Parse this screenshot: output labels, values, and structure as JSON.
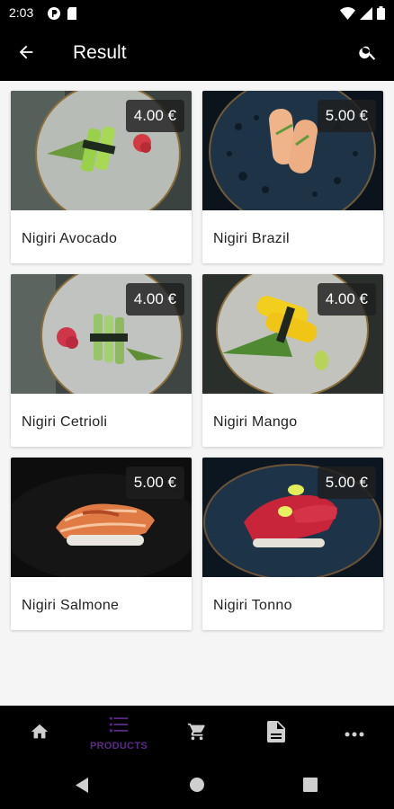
{
  "status_bar": {
    "time": "2:03",
    "icons": [
      "media-icon",
      "sim-card-icon",
      "wifi-icon",
      "signal-icon",
      "battery-icon"
    ]
  },
  "app_bar": {
    "title": "Result",
    "back_icon": "arrow-back-icon",
    "search_icon": "search-icon"
  },
  "products": [
    {
      "name": "Nigiri Avocado",
      "price": "4.00 €",
      "image": "avocado"
    },
    {
      "name": "Nigiri Brazil",
      "price": "5.00 €",
      "image": "brazil"
    },
    {
      "name": "Nigiri Cetrioli",
      "price": "4.00 €",
      "image": "cetrioli"
    },
    {
      "name": "Nigiri Mango",
      "price": "4.00 €",
      "image": "mango"
    },
    {
      "name": "Nigiri Salmone",
      "price": "5.00 €",
      "image": "salmone"
    },
    {
      "name": "Nigiri Tonno",
      "price": "5.00 €",
      "image": "tonno"
    }
  ],
  "bottom_nav": {
    "items": [
      {
        "icon": "home-icon",
        "label": ""
      },
      {
        "icon": "list-icon",
        "label": "PRODUCTS",
        "active": true
      },
      {
        "icon": "cart-icon",
        "label": ""
      },
      {
        "icon": "document-icon",
        "label": ""
      },
      {
        "icon": "more-icon",
        "label": ""
      }
    ],
    "active_color": "#5b2a86"
  },
  "system_nav": [
    "back-triangle-icon",
    "home-circle-icon",
    "recents-square-icon"
  ]
}
